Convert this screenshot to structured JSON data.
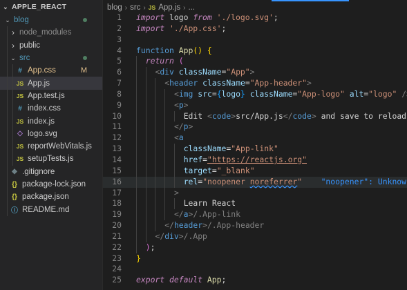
{
  "explorer": {
    "root": "APPLE_REACT",
    "items": [
      {
        "label": "blog",
        "kind": "folder",
        "depth": 0,
        "open": true,
        "status": "dot",
        "color": "#519aba"
      },
      {
        "label": "node_modules",
        "kind": "folder",
        "depth": 1,
        "open": false,
        "dim": true
      },
      {
        "label": "public",
        "kind": "folder",
        "depth": 1,
        "open": false
      },
      {
        "label": "src",
        "kind": "folder",
        "depth": 1,
        "open": true,
        "status": "dot",
        "color": "#519aba"
      },
      {
        "label": "App.css",
        "kind": "file",
        "icon": "css",
        "depth": 2,
        "status": "M",
        "modified": true
      },
      {
        "label": "App.js",
        "kind": "file",
        "icon": "js",
        "depth": 2,
        "selected": true
      },
      {
        "label": "App.test.js",
        "kind": "file",
        "icon": "js",
        "depth": 2
      },
      {
        "label": "index.css",
        "kind": "file",
        "icon": "css",
        "depth": 2
      },
      {
        "label": "index.js",
        "kind": "file",
        "icon": "js",
        "depth": 2
      },
      {
        "label": "logo.svg",
        "kind": "file",
        "icon": "svg",
        "depth": 2
      },
      {
        "label": "reportWebVitals.js",
        "kind": "file",
        "icon": "js",
        "depth": 2
      },
      {
        "label": "setupTests.js",
        "kind": "file",
        "icon": "js",
        "depth": 2
      },
      {
        "label": ".gitignore",
        "kind": "file",
        "icon": "git",
        "depth": 1
      },
      {
        "label": "package-lock.json",
        "kind": "file",
        "icon": "json",
        "depth": 1
      },
      {
        "label": "package.json",
        "kind": "file",
        "icon": "json",
        "depth": 1
      },
      {
        "label": "README.md",
        "kind": "file",
        "icon": "md",
        "depth": 1
      }
    ]
  },
  "breadcrumb": {
    "parts": [
      "blog",
      "src"
    ],
    "file_badge": "JS",
    "file": "App.js",
    "more": "..."
  },
  "icons": {
    "chevron_open": "chevron-down-icon",
    "chevron_closed": "chevron-right-icon",
    "js": "JS",
    "css": "#",
    "json": "{}",
    "md": "ⓘ",
    "svg": "◇",
    "git": "◆"
  },
  "editor": {
    "highlighted_line": 16,
    "lines": [
      {
        "n": "1",
        "indent": 0,
        "tokens": [
          [
            "k",
            "import"
          ],
          [
            "p",
            " logo "
          ],
          [
            "k",
            "from"
          ],
          [
            "p",
            " "
          ],
          [
            "s",
            "'./logo.svg'"
          ],
          [
            "p",
            ";"
          ]
        ]
      },
      {
        "n": "2",
        "indent": 0,
        "tokens": [
          [
            "k",
            "import"
          ],
          [
            "p",
            " "
          ],
          [
            "s",
            "'./App.css'"
          ],
          [
            "p",
            ";"
          ]
        ]
      },
      {
        "n": "3",
        "indent": 0,
        "tokens": []
      },
      {
        "n": "4",
        "indent": 0,
        "tokens": [
          [
            "k2",
            "function"
          ],
          [
            "p",
            " "
          ],
          [
            "f",
            "App"
          ],
          [
            "yb",
            "()"
          ],
          [
            "p",
            " "
          ],
          [
            "yb",
            "{"
          ]
        ]
      },
      {
        "n": "5",
        "indent": 1,
        "tokens": [
          [
            "k",
            "return"
          ],
          [
            "p",
            " "
          ],
          [
            "pb",
            "("
          ]
        ]
      },
      {
        "n": "6",
        "indent": 2,
        "tokens": [
          [
            "br",
            "<"
          ],
          [
            "t",
            "div"
          ],
          [
            "p",
            " "
          ],
          [
            "a",
            "className"
          ],
          [
            "p",
            "="
          ],
          [
            "s",
            "\"App\""
          ],
          [
            "br",
            ">"
          ]
        ]
      },
      {
        "n": "7",
        "indent": 3,
        "tokens": [
          [
            "br",
            "<"
          ],
          [
            "t",
            "header"
          ],
          [
            "p",
            " "
          ],
          [
            "a",
            "className"
          ],
          [
            "p",
            "="
          ],
          [
            "s",
            "\"App-header\""
          ],
          [
            "br",
            ">"
          ]
        ]
      },
      {
        "n": "8",
        "indent": 4,
        "tokens": [
          [
            "br",
            "<"
          ],
          [
            "t",
            "img"
          ],
          [
            "p",
            " "
          ],
          [
            "a",
            "src"
          ],
          [
            "p",
            "="
          ],
          [
            "bb",
            "{"
          ],
          [
            "v",
            "logo"
          ],
          [
            "bb",
            "}"
          ],
          [
            "p",
            " "
          ],
          [
            "a",
            "className"
          ],
          [
            "p",
            "="
          ],
          [
            "s",
            "\"App-logo\""
          ],
          [
            "p",
            " "
          ],
          [
            "a",
            "alt"
          ],
          [
            "p",
            "="
          ],
          [
            "s",
            "\"logo\""
          ],
          [
            "p",
            " "
          ],
          [
            "br",
            "/>"
          ]
        ]
      },
      {
        "n": "9",
        "indent": 4,
        "tokens": [
          [
            "br",
            "<"
          ],
          [
            "t",
            "p"
          ],
          [
            "br",
            ">"
          ]
        ]
      },
      {
        "n": "10",
        "indent": 5,
        "tokens": [
          [
            "p",
            "Edit "
          ],
          [
            "br",
            "<"
          ],
          [
            "t",
            "code"
          ],
          [
            "br",
            ">"
          ],
          [
            "p",
            "src/App.js"
          ],
          [
            "br",
            "</"
          ],
          [
            "t",
            "code"
          ],
          [
            "br",
            ">"
          ],
          [
            "p",
            " and save to reload."
          ]
        ]
      },
      {
        "n": "11",
        "indent": 4,
        "tokens": [
          [
            "br",
            "</"
          ],
          [
            "t",
            "p"
          ],
          [
            "br",
            ">"
          ]
        ]
      },
      {
        "n": "12",
        "indent": 4,
        "tokens": [
          [
            "br",
            "<"
          ],
          [
            "t",
            "a"
          ]
        ]
      },
      {
        "n": "13",
        "indent": 5,
        "tokens": [
          [
            "a",
            "className"
          ],
          [
            "p",
            "="
          ],
          [
            "s",
            "\"App-link\""
          ]
        ]
      },
      {
        "n": "14",
        "indent": 5,
        "tokens": [
          [
            "a",
            "href"
          ],
          [
            "p",
            "="
          ],
          [
            "su",
            "\"https://reactjs.org\""
          ]
        ]
      },
      {
        "n": "15",
        "indent": 5,
        "tokens": [
          [
            "a",
            "target"
          ],
          [
            "p",
            "="
          ],
          [
            "s",
            "\"_blank\""
          ]
        ]
      },
      {
        "n": "16",
        "indent": 5,
        "tokens": [
          [
            "a",
            "rel"
          ],
          [
            "p",
            "="
          ],
          [
            "s",
            "\"noopener "
          ],
          [
            "sq",
            "noreferrer"
          ],
          [
            "s",
            "\""
          ],
          [
            "p",
            "    "
          ],
          [
            "diag",
            "\"noopener\": Unknown wo"
          ]
        ]
      },
      {
        "n": "17",
        "indent": 4,
        "tokens": [
          [
            "br",
            ">"
          ]
        ]
      },
      {
        "n": "18",
        "indent": 5,
        "tokens": [
          [
            "p",
            "Learn React"
          ]
        ]
      },
      {
        "n": "19",
        "indent": 4,
        "tokens": [
          [
            "br",
            "</"
          ],
          [
            "t",
            "a"
          ],
          [
            "br",
            ">"
          ],
          [
            "br",
            "/.App-link"
          ]
        ]
      },
      {
        "n": "20",
        "indent": 3,
        "tokens": [
          [
            "br",
            "</"
          ],
          [
            "t",
            "header"
          ],
          [
            "br",
            ">"
          ],
          [
            "br",
            "/.App-header"
          ]
        ]
      },
      {
        "n": "21",
        "indent": 2,
        "tokens": [
          [
            "br",
            "</"
          ],
          [
            "t",
            "div"
          ],
          [
            "br",
            ">"
          ],
          [
            "br",
            "/.App"
          ]
        ]
      },
      {
        "n": "22",
        "indent": 1,
        "tokens": [
          [
            "pb",
            ")"
          ],
          [
            "p",
            ";"
          ]
        ]
      },
      {
        "n": "23",
        "indent": 0,
        "tokens": [
          [
            "yb",
            "}"
          ]
        ]
      },
      {
        "n": "24",
        "indent": 0,
        "tokens": []
      },
      {
        "n": "25",
        "indent": 0,
        "tokens": [
          [
            "k",
            "export"
          ],
          [
            "p",
            " "
          ],
          [
            "k",
            "default"
          ],
          [
            "p",
            " "
          ],
          [
            "f",
            "App"
          ],
          [
            "p",
            ";"
          ]
        ]
      }
    ]
  },
  "colors": {
    "keyword": "#c586c0",
    "string": "#ce9178",
    "function": "#dcdcaa",
    "tag": "#569cd6",
    "attr": "#9cdcfe",
    "accent": "#3794ff",
    "modified": "#e2c08d"
  }
}
